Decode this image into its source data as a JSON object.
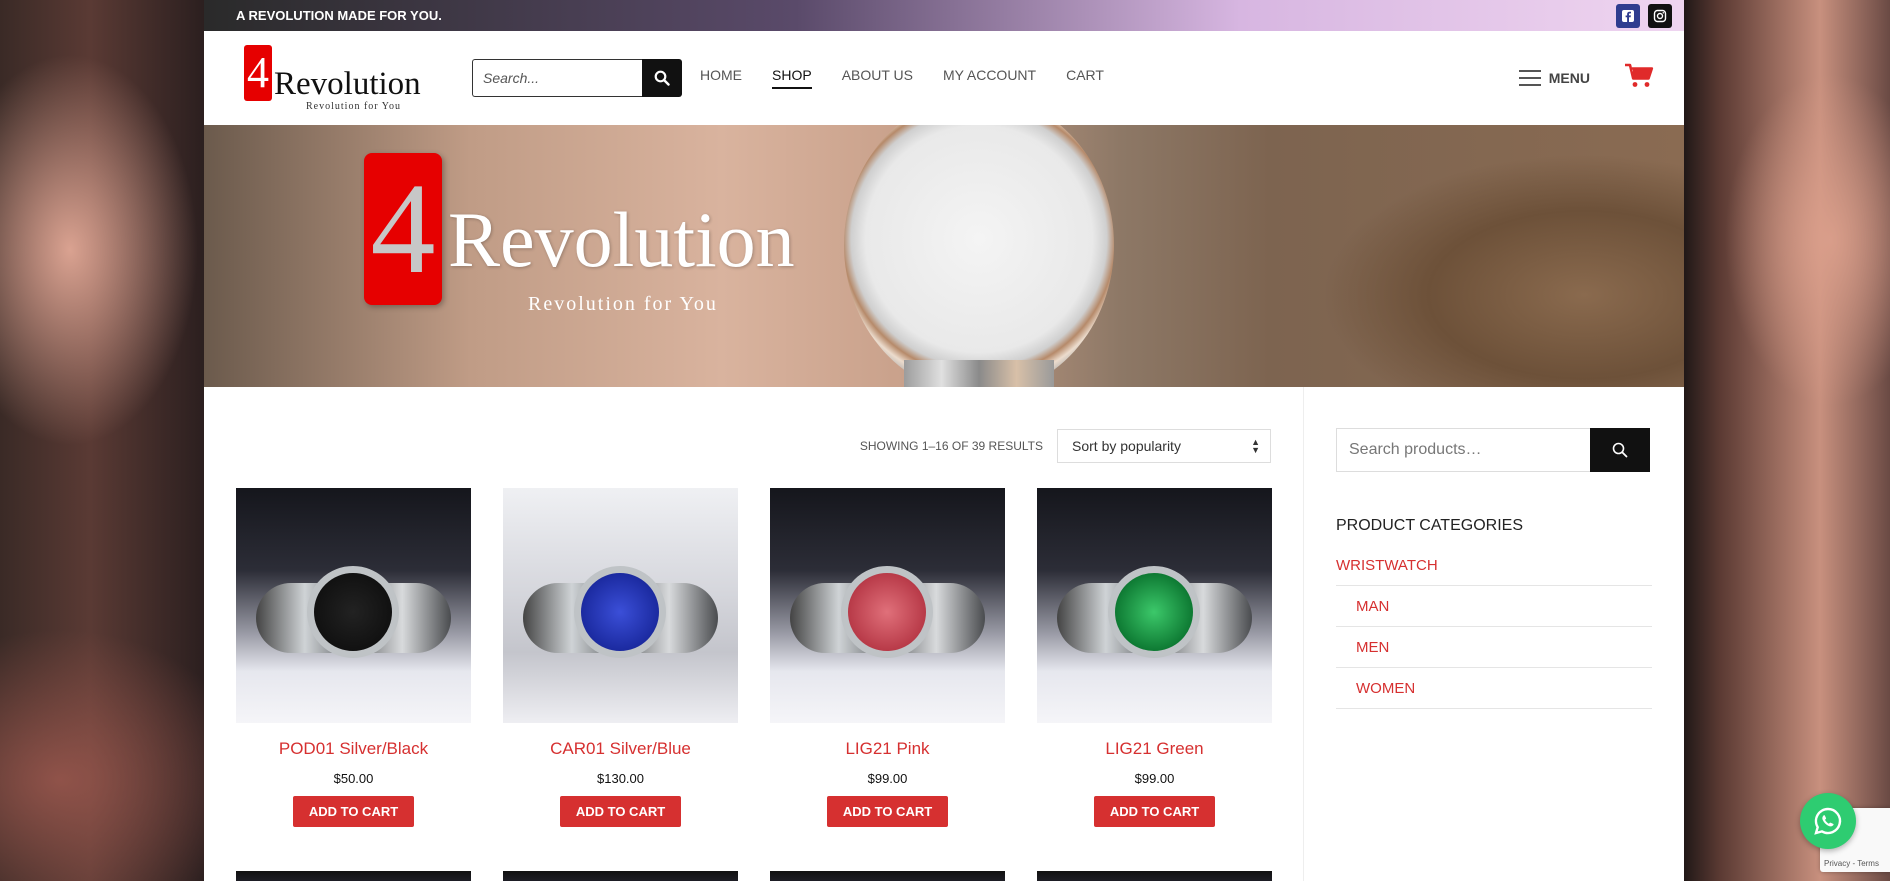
{
  "topbar": {
    "tagline": "A REVOLUTION MADE FOR YOU.",
    "social": [
      "facebook-icon",
      "instagram-icon"
    ]
  },
  "header": {
    "logo": {
      "mark": "4",
      "name": "Revolution",
      "sub": "Revolution for You"
    },
    "search": {
      "placeholder": "Search..."
    },
    "nav": [
      "HOME",
      "SHOP",
      "ABOUT US",
      "MY ACCOUNT",
      "CART"
    ],
    "active_nav": "SHOP",
    "menu_label": "MENU"
  },
  "banner": {
    "mark": "4",
    "name": "Revolution",
    "sub": "Revolution for You"
  },
  "shop": {
    "result_count": "SHOWING 1–16 OF 39 RESULTS",
    "sort_selected": "Sort by popularity",
    "products": [
      {
        "title": "POD01 Silver/Black",
        "price": "$50.00",
        "cta": "ADD TO CART"
      },
      {
        "title": "CAR01 Silver/Blue",
        "price": "$130.00",
        "cta": "ADD TO CART"
      },
      {
        "title": "LIG21 Pink",
        "price": "$99.00",
        "cta": "ADD TO CART"
      },
      {
        "title": "LIG21 Green",
        "price": "$99.00",
        "cta": "ADD TO CART"
      }
    ]
  },
  "sidebar": {
    "search_placeholder": "Search products…",
    "categories_title": "PRODUCT CATEGORIES",
    "categories": [
      "WRISTWATCH",
      "MAN",
      "MEN",
      "WOMEN"
    ]
  },
  "recaptcha": {
    "text": "Privacy - Terms"
  },
  "colors": {
    "accent": "#d63030",
    "logo_red": "#e60000",
    "dark": "#111111",
    "whatsapp": "#2ecc71"
  }
}
